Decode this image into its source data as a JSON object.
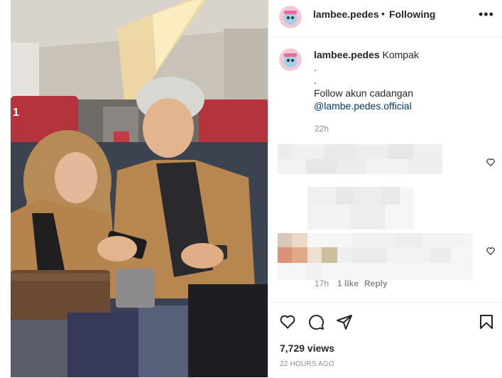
{
  "post": {
    "username": "lambee.pedes",
    "follow_status": "Following",
    "more_icon": "more-options-icon",
    "separator": "•"
  },
  "caption": {
    "username": "lambee.pedes",
    "first_line": "Kompak",
    "line2": ".",
    "line3": ".",
    "line4": "Follow akun cadangan",
    "mention": "@lambe.pedes.official",
    "time": "22h"
  },
  "comment2_meta": {
    "time": "17h",
    "likes": "1 like",
    "reply": "Reply"
  },
  "actions": {
    "icons": [
      "heart-icon",
      "comment-icon",
      "share-icon",
      "bookmark-icon"
    ]
  },
  "stats": {
    "views": "7,729 views",
    "posted": "22 HOURS AGO"
  },
  "colors": {
    "text": "#262626",
    "muted": "#8e8e8e",
    "mention": "#00376b",
    "border": "#dbdbdb"
  }
}
